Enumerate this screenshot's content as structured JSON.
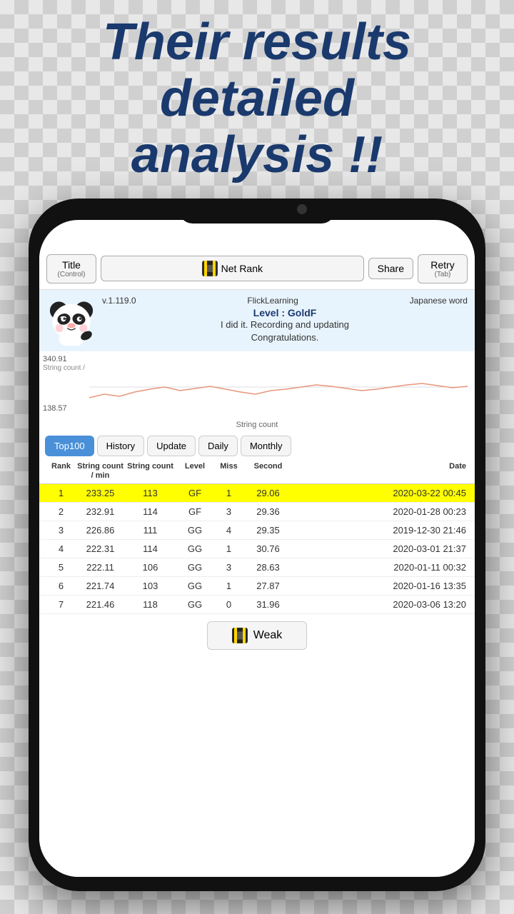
{
  "headline": {
    "line1": "Their results",
    "line2": "detailed",
    "line3": "analysis !!"
  },
  "toolbar": {
    "title_label": "Title",
    "title_sub": "(Control)",
    "net_rank_label": "Net Rank",
    "share_label": "Share",
    "retry_label": "Retry",
    "retry_sub": "(Tab)"
  },
  "info": {
    "version": "v.1.119.0",
    "app_name": "FlickLearning",
    "japanese_word": "Japanese word",
    "level": "Level : GoldF",
    "message_line1": "I did it. Recording and updating",
    "message_line2": "Congratulations."
  },
  "chart": {
    "y_top": "340.91",
    "y_label": "String count /",
    "y_bottom": "138.57",
    "x_label": "String count"
  },
  "tabs": [
    {
      "id": "top100",
      "label": "Top100",
      "active": true
    },
    {
      "id": "history",
      "label": "History",
      "active": false
    },
    {
      "id": "update",
      "label": "Update",
      "active": false
    },
    {
      "id": "daily",
      "label": "Daily",
      "active": false
    },
    {
      "id": "monthly",
      "label": "Monthly",
      "active": false
    }
  ],
  "table": {
    "headers": {
      "rank": "Rank",
      "string_count_min": "String count / min",
      "string_count": "String count",
      "level": "Level",
      "miss": "Miss",
      "second": "Second",
      "date": "Date"
    },
    "rows": [
      {
        "rank": "1",
        "sc_min": "233.25",
        "sc": "113",
        "level": "GF",
        "miss": "1",
        "second": "29.06",
        "date": "2020-03-22 00:45",
        "highlighted": true
      },
      {
        "rank": "2",
        "sc_min": "232.91",
        "sc": "114",
        "level": "GF",
        "miss": "3",
        "second": "29.36",
        "date": "2020-01-28 00:23",
        "highlighted": false
      },
      {
        "rank": "3",
        "sc_min": "226.86",
        "sc": "111",
        "level": "GG",
        "miss": "4",
        "second": "29.35",
        "date": "2019-12-30 21:46",
        "highlighted": false
      },
      {
        "rank": "4",
        "sc_min": "222.31",
        "sc": "114",
        "level": "GG",
        "miss": "1",
        "second": "30.76",
        "date": "2020-03-01 21:37",
        "highlighted": false
      },
      {
        "rank": "5",
        "sc_min": "222.11",
        "sc": "106",
        "level": "GG",
        "miss": "3",
        "second": "28.63",
        "date": "2020-01-11 00:32",
        "highlighted": false
      },
      {
        "rank": "6",
        "sc_min": "221.74",
        "sc": "103",
        "level": "GG",
        "miss": "1",
        "second": "27.87",
        "date": "2020-01-16 13:35",
        "highlighted": false
      },
      {
        "rank": "7",
        "sc_min": "221.46",
        "sc": "118",
        "level": "GG",
        "miss": "0",
        "second": "31.96",
        "date": "2020-03-06 13:20",
        "highlighted": false
      }
    ]
  },
  "weak_button": {
    "label": "Weak"
  }
}
